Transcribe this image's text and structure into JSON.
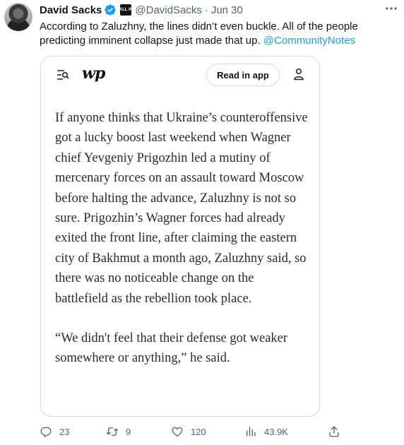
{
  "tweet": {
    "author_name": "David Sacks",
    "handle": "@DavidSacks",
    "separator": "·",
    "date": "Jun 30",
    "affiliate_badge_text": "ALL IN",
    "text_before_mention": "According to Zaluzhny, the lines didn’t even buckle. All of the people predicting imminent collapse just made that up.",
    "mention": "@CommunityNotes"
  },
  "card": {
    "logo_text": "wp",
    "read_in_app_label": "Read in app",
    "paragraphs": [
      "If anyone thinks that Ukraine’s counteroffensive got a lucky boost last weekend when Wagner chief Yevgeniy Prigozhin led a mutiny of mercenary forces on an assault toward Moscow before halting the advance, Zaluzhny is not so sure. Prigozhin’s Wagner forces had already exited the front line, after claiming the eastern city of Bakhmut a month ago, Zaluzhny said, so there was no noticeable change on the battlefield as the rebellion took place.",
      "“We didn't feel that their defense got weaker somewhere or anything,” he said."
    ]
  },
  "actions": {
    "replies": "23",
    "retweets": "9",
    "likes": "120",
    "views": "43.9K"
  },
  "icons": {
    "verified": "verified-badge-icon",
    "more": "more-horizontal-icon",
    "reply": "reply-icon",
    "retweet": "retweet-icon",
    "like": "heart-icon",
    "views": "views-chart-icon",
    "share": "share-icon",
    "menu": "menu-search-icon",
    "user": "user-icon"
  },
  "colors": {
    "text": "#0f1419",
    "secondary": "#536471",
    "link": "#1d9bf0",
    "verified": "#1d9bf0",
    "border": "#cfd9de"
  }
}
